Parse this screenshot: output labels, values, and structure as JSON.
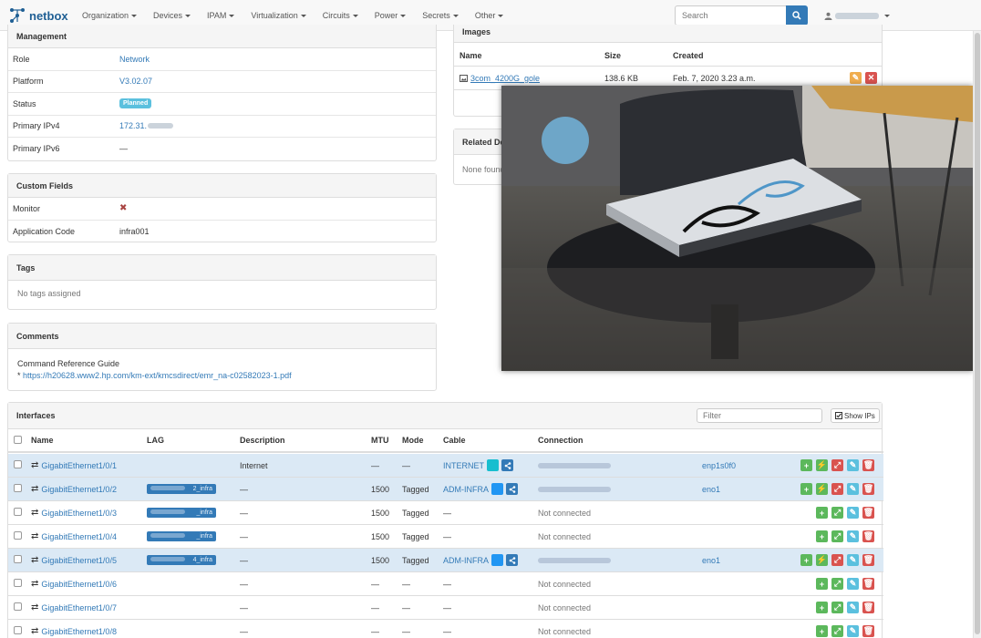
{
  "nav": {
    "brand": "netbox",
    "menu": [
      "Organization",
      "Devices",
      "IPAM",
      "Virtualization",
      "Circuits",
      "Power",
      "Secrets",
      "Other"
    ],
    "search_placeholder": "Search"
  },
  "management": {
    "title": "Management",
    "rows": [
      {
        "key": "Role",
        "value": "Network"
      },
      {
        "key": "Platform",
        "value": "V3.02.07"
      },
      {
        "key": "Status",
        "value": "Planned"
      },
      {
        "key": "Primary IPv4",
        "value": "172.31."
      },
      {
        "key": "Primary IPv6",
        "value": "—"
      }
    ]
  },
  "custom_fields": {
    "title": "Custom Fields",
    "monitor_label": "Monitor",
    "monitor_value": "✖",
    "app_code_label": "Application Code",
    "app_code_value": "infra001"
  },
  "tags": {
    "title": "Tags",
    "empty": "No tags assigned"
  },
  "comments": {
    "title": "Comments",
    "line1": "Command Reference Guide",
    "bullet": "* ",
    "link": "https://h20628.www2.hp.com/km-ext/kmcsdirect/emr_na-c02582023-1.pdf"
  },
  "images": {
    "title": "Images",
    "columns": [
      "Name",
      "Size",
      "Created"
    ],
    "row": {
      "name": "3com_4200G_gole",
      "size": "138.6 KB",
      "created": "Feb. 7, 2020 3.23 a.m."
    }
  },
  "related": {
    "title": "Related De",
    "empty": "None found"
  },
  "interfaces": {
    "title": "Interfaces",
    "filter_placeholder": "Filter",
    "show_ips": "Show IPs",
    "columns": [
      "Name",
      "LAG",
      "Description",
      "MTU",
      "Mode",
      "Cable",
      "Connection"
    ],
    "rows": [
      {
        "name": "GigabitEthernet1/0/1",
        "lag": "",
        "desc": "Internet",
        "mtu": "—",
        "mode": "—",
        "cable": "INTERNET",
        "cable_color": "#17becf",
        "conn": "",
        "peer": "enp1s0f0",
        "hl": true,
        "connected": true
      },
      {
        "name": "GigabitEthernet1/0/2",
        "lag": "2_infra",
        "desc": "—",
        "mtu": "1500",
        "mode": "Tagged",
        "cable": "ADM-INFRA",
        "cable_color": "#2196f3",
        "conn": "",
        "peer": "eno1",
        "hl": true,
        "connected": true
      },
      {
        "name": "GigabitEthernet1/0/3",
        "lag": "_infra",
        "desc": "—",
        "mtu": "1500",
        "mode": "Tagged",
        "cable": "—",
        "cable_color": "",
        "conn": "Not connected",
        "peer": "",
        "hl": false,
        "connected": false
      },
      {
        "name": "GigabitEthernet1/0/4",
        "lag": "_infra",
        "desc": "—",
        "mtu": "1500",
        "mode": "Tagged",
        "cable": "—",
        "cable_color": "",
        "conn": "Not connected",
        "peer": "",
        "hl": false,
        "connected": false
      },
      {
        "name": "GigabitEthernet1/0/5",
        "lag": "4_infra",
        "desc": "—",
        "mtu": "1500",
        "mode": "Tagged",
        "cable": "ADM-INFRA",
        "cable_color": "#2196f3",
        "conn": "",
        "peer": "eno1",
        "hl": true,
        "connected": true
      },
      {
        "name": "GigabitEthernet1/0/6",
        "lag": "",
        "desc": "—",
        "mtu": "—",
        "mode": "—",
        "cable": "—",
        "cable_color": "",
        "conn": "Not connected",
        "peer": "",
        "hl": false,
        "connected": false
      },
      {
        "name": "GigabitEthernet1/0/7",
        "lag": "",
        "desc": "—",
        "mtu": "—",
        "mode": "—",
        "cable": "—",
        "cable_color": "",
        "conn": "Not connected",
        "peer": "",
        "hl": false,
        "connected": false
      },
      {
        "name": "GigabitEthernet1/0/8",
        "lag": "",
        "desc": "—",
        "mtu": "—",
        "mode": "—",
        "cable": "—",
        "cable_color": "",
        "conn": "Not connected",
        "peer": "",
        "hl": false,
        "connected": false
      }
    ]
  }
}
